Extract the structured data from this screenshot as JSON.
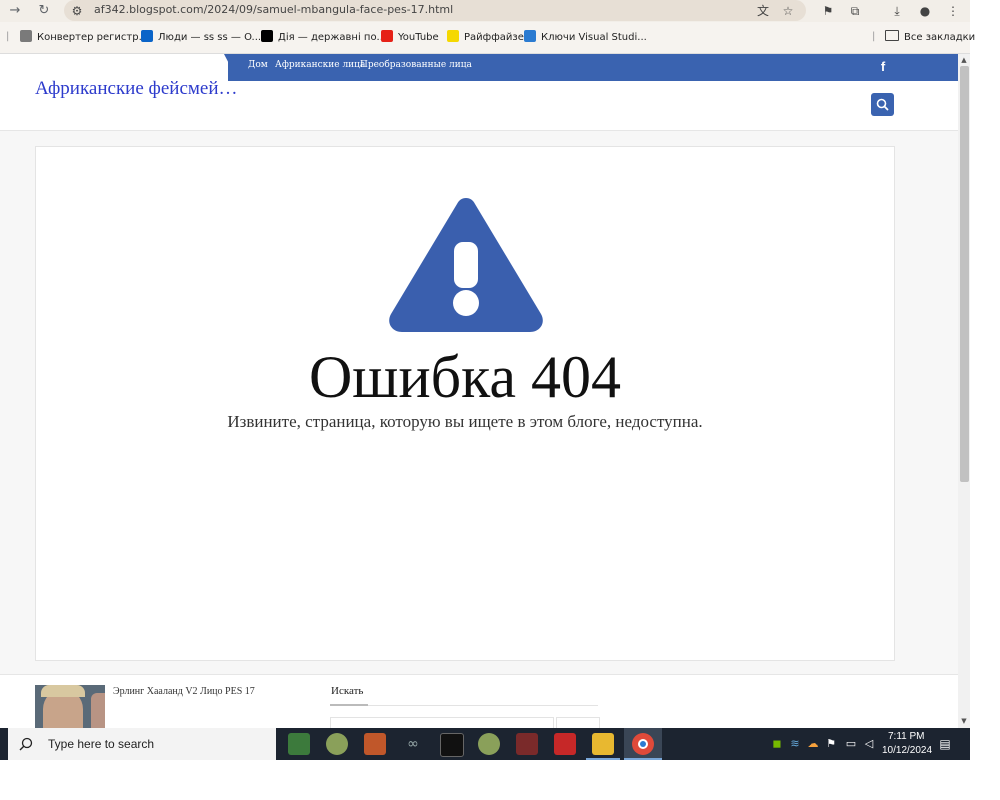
{
  "browser": {
    "url": "af342.blogspot.com/2024/09/samuel-mbangula-face-pes-17.html",
    "bookmarks": [
      {
        "label": "Конвертер регистр...",
        "icon": "converter-icon",
        "color": "#7a7a7a"
      },
      {
        "label": "Люди — ss ss — O...",
        "icon": "outlook-icon",
        "color": "#0a64c8"
      },
      {
        "label": "Дія — державні по...",
        "icon": "diia-icon",
        "color": "#000000"
      },
      {
        "label": "YouTube",
        "icon": "youtube-icon",
        "color": "#e62117"
      },
      {
        "label": "Райффайзен",
        "icon": "raiffeisen-icon",
        "color": "#f5d800"
      },
      {
        "label": "Ключи Visual Studi...",
        "icon": "monitor-icon",
        "color": "#2b7bd1"
      }
    ],
    "all_bookmarks": "Все закладки"
  },
  "site": {
    "title": "Африканские фейсмей…",
    "nav": [
      "Дом",
      "Африканские лица",
      "Преобразованные лица"
    ],
    "accent": "#3a63b0"
  },
  "error": {
    "title": "Ошибка 404",
    "message": "Извините, страница, которую вы ищете в этом блоге, недоступна."
  },
  "footer": {
    "post_title": "Эрлинг Хааланд V2 Лицо PES 17",
    "search_heading": "Искать"
  },
  "taskbar": {
    "search_placeholder": "Type here to search",
    "time": "7:11 PM",
    "date": "10/12/2024"
  }
}
